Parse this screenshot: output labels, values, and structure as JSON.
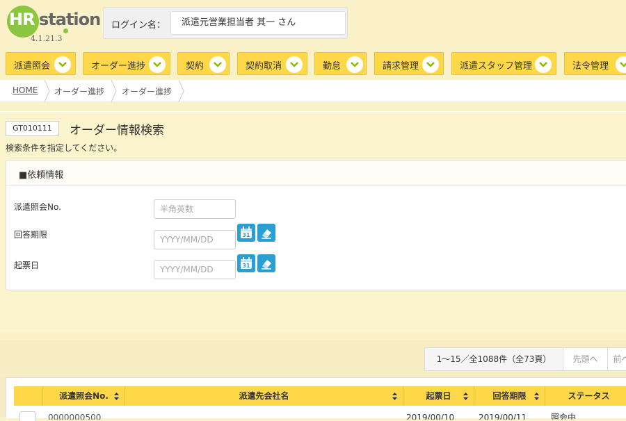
{
  "app": {
    "logo_hr": "HR",
    "logo_station": "station",
    "version": "4.1.21.3"
  },
  "login": {
    "label": "ログイン名：",
    "value": "派遣元営業担当者 其一 さん"
  },
  "nav": {
    "items": [
      {
        "label": "派遣照会"
      },
      {
        "label": "オーダー進捗"
      },
      {
        "label": "契約"
      },
      {
        "label": "契約取消"
      },
      {
        "label": "勤怠"
      },
      {
        "label": "請求管理"
      },
      {
        "label": "派遣スタッフ管理"
      },
      {
        "label": "法令管理"
      }
    ]
  },
  "breadcrumb": {
    "items": [
      {
        "label": "HOME"
      },
      {
        "label": "オーダー進捗"
      },
      {
        "label": "オーダー進捗"
      }
    ]
  },
  "page": {
    "screen_id": "GT010111",
    "title": "オーダー情報検索",
    "instruction": "検索条件を指定してください。"
  },
  "panel": {
    "title": "■依頼情報",
    "fields": [
      {
        "label": "派遣照会No.",
        "placeholder": "半角英数"
      },
      {
        "label": "回答期限",
        "placeholder": "YYYY/MM/DD"
      },
      {
        "label": "起票日",
        "placeholder": "YYYY/MM/DD"
      }
    ]
  },
  "pager": {
    "count": "1〜15／全1088件（全73頁）",
    "first": "先頭へ",
    "prev": "前へ"
  },
  "table": {
    "columns": [
      "派遣照会No.",
      "派遣先会社名",
      "起票日",
      "回答期限",
      "ステータス"
    ],
    "rows": [
      {
        "no": "0000000500",
        "company": "ㅤㅤㅤ",
        "created": "2019/00/10",
        "deadline": "2019/00/11",
        "status": "照会中"
      }
    ]
  },
  "colors": {
    "accent": "#ffd84a",
    "background": "#faf1c8",
    "logo_green": "#8cc63f",
    "icon_blue": "#2a9fd6"
  }
}
